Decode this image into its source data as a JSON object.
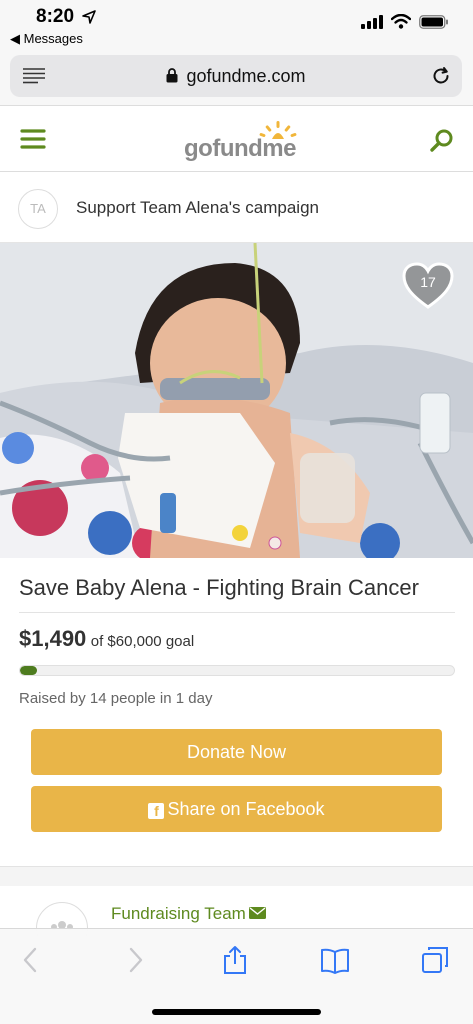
{
  "status": {
    "time": "8:20",
    "back_app": "◀ Messages"
  },
  "browser": {
    "url": "gofundme.com"
  },
  "header": {
    "logo": "gofundme"
  },
  "organizer": {
    "initials": "TA",
    "label": "Support Team Alena's campaign"
  },
  "hero": {
    "likes": "17"
  },
  "campaign": {
    "title": "Save Baby Alena - Fighting Brain Cancer",
    "raised_amount": "$1,490",
    "goal_text": "of $60,000 goal",
    "progress_fraction": 0.025,
    "raised_by": "Raised by 14 people in 1 day",
    "donate_label": "Donate Now",
    "share_label": "Share on Facebook"
  },
  "team": {
    "label": "Fundraising Team"
  },
  "colors": {
    "accent_green": "#5e8a1f",
    "button_gold": "#e9b548",
    "progress_green": "#4e7c1f"
  },
  "icons": [
    "location-arrow-icon",
    "signal-icon",
    "wifi-icon",
    "battery-icon",
    "reader-icon",
    "lock-icon",
    "reload-icon",
    "hamburger-menu-icon",
    "search-icon",
    "heart-icon",
    "facebook-icon",
    "mail-icon",
    "back-icon",
    "forward-icon",
    "share-icon",
    "bookmarks-icon",
    "tabs-icon"
  ]
}
